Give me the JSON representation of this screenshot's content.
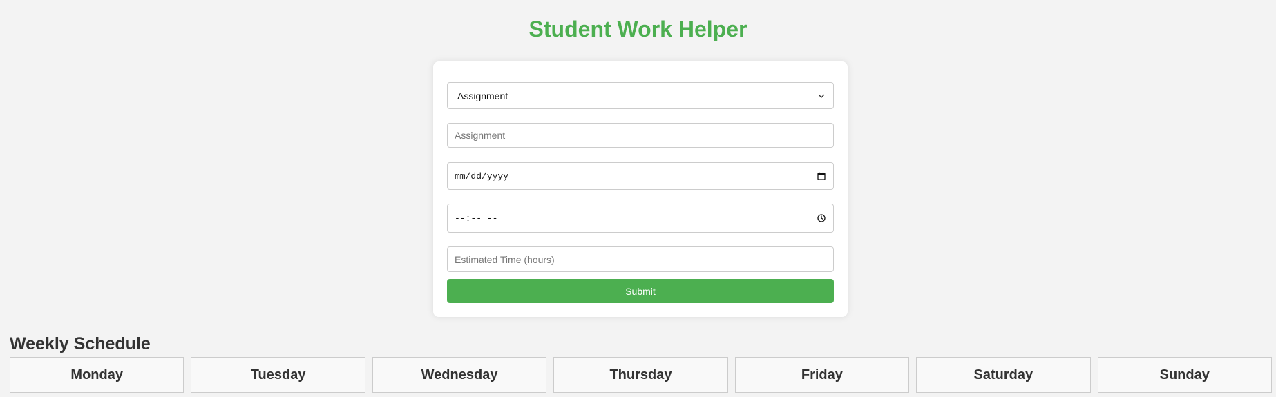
{
  "header": {
    "title": "Student Work Helper"
  },
  "form": {
    "type_select": {
      "selected": "Assignment",
      "icon": "chevron-down-icon"
    },
    "name_input": {
      "placeholder": "Assignment"
    },
    "date_input": {
      "placeholder": "mm/dd/yyyy",
      "icon": "calendar-icon"
    },
    "time_input": {
      "placeholder": "--:-- --",
      "icon": "clock-icon"
    },
    "hours_input": {
      "placeholder": "Estimated Time (hours)"
    },
    "submit_label": "Submit"
  },
  "schedule": {
    "title": "Weekly Schedule",
    "days": [
      "Monday",
      "Tuesday",
      "Wednesday",
      "Thursday",
      "Friday",
      "Saturday",
      "Sunday"
    ]
  },
  "colors": {
    "accent": "#4caf50",
    "background": "#f3f3f3",
    "card": "#ffffff",
    "day_cell": "#f9f9f9"
  }
}
